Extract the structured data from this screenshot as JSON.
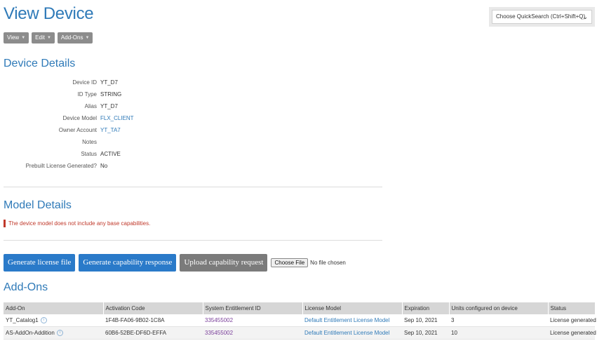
{
  "page": {
    "title": "View Device"
  },
  "quicksearch": {
    "label": "Choose QuickSearch (Ctrl+Shift+Q)"
  },
  "toolbar": {
    "view": "View",
    "edit": "Edit",
    "addons": "Add-Ons"
  },
  "device_details": {
    "title": "Device Details",
    "rows": [
      {
        "label": "Device ID",
        "value": "YT_D7"
      },
      {
        "label": "ID Type",
        "value": "STRING"
      },
      {
        "label": "Alias",
        "value": "YT_D7"
      },
      {
        "label": "Device Model",
        "value": "FLX_CLIENT"
      },
      {
        "label": "Owner Account",
        "value": "YT_TA7"
      },
      {
        "label": "Notes",
        "value": ""
      },
      {
        "label": "Status",
        "value": "ACTIVE"
      },
      {
        "label": "Prebuilt License Generated?",
        "value": "No"
      }
    ]
  },
  "model_details": {
    "title": "Model Details",
    "warning": "The device model does not include any base capabilities."
  },
  "actions": {
    "generate_license": "Generate license file",
    "generate_capability": "Generate capability response",
    "upload_capability": "Upload capability request",
    "choose_file": "Choose File",
    "no_file": "No file chosen"
  },
  "addons": {
    "title": "Add-Ons",
    "columns": [
      "Add-On",
      "Activation Code",
      "System Entitlement ID",
      "License Model",
      "Expiration",
      "Units configured on device",
      "Status"
    ],
    "rows": [
      {
        "addon": "YT_Catalog1",
        "activation": "1F4B-FA06-9B02-1C8A",
        "entitlement": "335455002",
        "model": "Default Entitlement License Model",
        "expiration": "Sep 10, 2021",
        "units": "3",
        "status": "License generated"
      },
      {
        "addon": "AS-AddOn-Addition",
        "activation": "60B6-52BE-DF6D-EFFA",
        "entitlement": "335455002",
        "model": "Default Entitlement License Model",
        "expiration": "Sep 10, 2021",
        "units": "10",
        "status": "License generated"
      }
    ]
  },
  "colors": {
    "accent": "#2f7ab8",
    "button_blue": "#2a7ac9",
    "button_gray": "#7b7b7b",
    "warning": "#c0392b"
  }
}
